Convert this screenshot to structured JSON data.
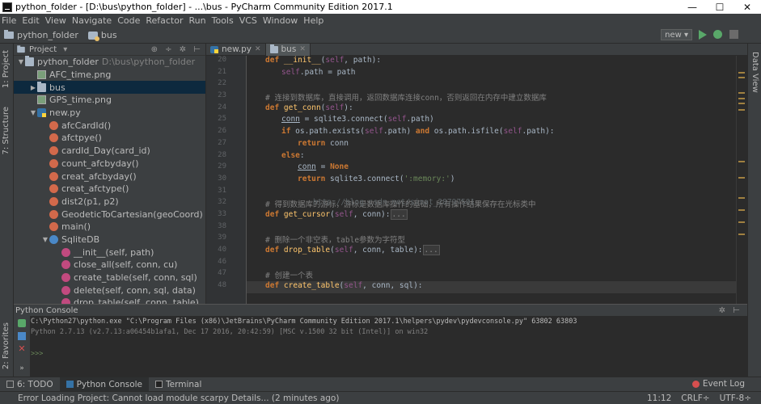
{
  "window": {
    "title": "python_folder - [D:\\bus\\python_folder] - ...\\bus - PyCharm Community Edition 2017.1",
    "minimize": "—",
    "maximize": "☐",
    "close": "✕"
  },
  "menu": [
    "File",
    "Edit",
    "View",
    "Navigate",
    "Code",
    "Refactor",
    "Run",
    "Tools",
    "VCS",
    "Window",
    "Help"
  ],
  "breadcrumb": {
    "project": "python_folder",
    "folder": "bus"
  },
  "run_config": {
    "label": "new ▾"
  },
  "side_tabs": {
    "project": "1: Project",
    "structure": "7: Structure",
    "favorites": "2: Favorites",
    "dataview": "Data View"
  },
  "project_panel": {
    "selector": "Project",
    "tree": [
      {
        "label": "python_folder",
        "path": "D:\\bus\\python_folder",
        "icon": "folder",
        "indent": 0,
        "arrow": "▼"
      },
      {
        "label": "AFC_time.png",
        "icon": "img",
        "indent": 1,
        "arrow": ""
      },
      {
        "label": "bus",
        "icon": "folder",
        "indent": 1,
        "arrow": "▶",
        "selected": true
      },
      {
        "label": "GPS_time.png",
        "icon": "img",
        "indent": 1,
        "arrow": ""
      },
      {
        "label": "new.py",
        "icon": "py",
        "indent": 1,
        "arrow": "▼"
      },
      {
        "label": "afcCardId()",
        "icon": "fn",
        "indent": 2,
        "arrow": ""
      },
      {
        "label": "afctpye()",
        "icon": "fn",
        "indent": 2,
        "arrow": ""
      },
      {
        "label": "cardId_Day(card_id)",
        "icon": "fn",
        "indent": 2,
        "arrow": ""
      },
      {
        "label": "count_afcbyday()",
        "icon": "fn",
        "indent": 2,
        "arrow": ""
      },
      {
        "label": "creat_afcbyday()",
        "icon": "fn",
        "indent": 2,
        "arrow": ""
      },
      {
        "label": "creat_afctype()",
        "icon": "fn",
        "indent": 2,
        "arrow": ""
      },
      {
        "label": "dist2(p1, p2)",
        "icon": "fn",
        "indent": 2,
        "arrow": ""
      },
      {
        "label": "GeodeticToCartesian(geoCoord)",
        "icon": "fn",
        "indent": 2,
        "arrow": ""
      },
      {
        "label": "main()",
        "icon": "fn",
        "indent": 2,
        "arrow": ""
      },
      {
        "label": "SqliteDB",
        "icon": "c",
        "indent": 2,
        "arrow": "▼"
      },
      {
        "label": "__init__(self, path)",
        "icon": "m",
        "indent": 3,
        "arrow": ""
      },
      {
        "label": "close_all(self, conn, cu)",
        "icon": "m",
        "indent": 3,
        "arrow": ""
      },
      {
        "label": "create_table(self, conn, sql)",
        "icon": "m",
        "indent": 3,
        "arrow": ""
      },
      {
        "label": "delete(self, conn, sql, data)",
        "icon": "m",
        "indent": 3,
        "arrow": ""
      },
      {
        "label": "drop_table(self, conn, table)",
        "icon": "m",
        "indent": 3,
        "arrow": ""
      }
    ]
  },
  "editor_tabs": [
    {
      "label": "new.py",
      "active": false
    },
    {
      "label": "bus",
      "active": true
    }
  ],
  "code_lines": [
    {
      "n": "20",
      "html": "<span class='kw'>def</span> <span class='fnn'>__init__</span><span class='plain'>(</span><span class='self'>self</span><span class='plain'>, path):</span>",
      "indent": 0
    },
    {
      "n": "21",
      "html": "<span class='self'>self</span><span class='plain'>.path = path</span>",
      "indent": 1
    },
    {
      "n": "22",
      "html": "",
      "indent": 0
    },
    {
      "n": "23",
      "html": "<span class='cm'># 连接到数据库，直接调用，返回数据库连接conn，否则返回在内存中建立数据库</span>",
      "indent": 0
    },
    {
      "n": "24",
      "html": "<span class='kw'>def</span> <span class='fnn'>get_conn</span><span class='plain'>(</span><span class='self'>self</span><span class='plain'>):</span>",
      "indent": 0
    },
    {
      "n": "25",
      "html": "<span class='plain' style='text-decoration:underline'>conn</span><span class='plain'> = sqlite3.connect(</span><span class='self'>self</span><span class='plain'>.path)</span>",
      "indent": 1
    },
    {
      "n": "26",
      "html": "<span class='kw'>if</span><span class='plain'> os.path.exists(</span><span class='self'>self</span><span class='plain'>.path) </span><span class='kw'>and</span><span class='plain'> os.path.isfile(</span><span class='self'>self</span><span class='plain'>.path):</span>",
      "indent": 1
    },
    {
      "n": "27",
      "html": "<span class='kw'>return</span><span class='plain'> conn</span>",
      "indent": 2
    },
    {
      "n": "28",
      "html": "<span class='kw'>else</span><span class='plain'>:</span>",
      "indent": 1
    },
    {
      "n": "29",
      "html": "<span class='plain' style='text-decoration:underline'>conn</span><span class='plain'> = </span><span class='kw'>None</span>",
      "indent": 2
    },
    {
      "n": "30",
      "html": "<span class='kw'>return</span><span class='plain'> sqlite3.connect(</span><span class='str'>':memory:'</span><span class='plain'>)</span>",
      "indent": 2
    },
    {
      "n": "31",
      "html": "",
      "indent": 0
    },
    {
      "n": "32",
      "html": "<span class='cm'># 得到数据库的游标，游标是数据库操作的基础，所有操作结果保存在光标类中</span>",
      "indent": 0
    },
    {
      "n": "33",
      "html": "<span class='kw'>def</span> <span class='fnn'>get_cursor</span><span class='plain'>(</span><span class='self'>self</span><span class='plain'>, conn):</span><span class='fold'>...</span>",
      "indent": 0
    },
    {
      "n": "38",
      "html": "",
      "indent": 0
    },
    {
      "n": "39",
      "html": "<span class='cm'># 删除一个非空表，table参数为字符型</span>",
      "indent": 0
    },
    {
      "n": "40",
      "html": "<span class='kw'>def</span> <span class='fnn'>drop_table</span><span class='plain'>(</span><span class='self'>self</span><span class='plain'>, conn, table):</span><span class='fold'>...</span>",
      "indent": 0
    },
    {
      "n": "46",
      "html": "",
      "indent": 0
    },
    {
      "n": "47",
      "html": "<span class='cm'># 创建一个表</span>",
      "indent": 0
    },
    {
      "n": "48",
      "html": "<span class='kw'>def</span> <span class='fnn'>create_table</span><span class='plain'>(</span><span class='self'>self</span><span class='plain'>, conn, sql):</span>",
      "indent": 0
    }
  ],
  "watermark": "http://blog.csdn.net/sinat_28797501",
  "console": {
    "title": "Python Console",
    "lines": [
      "C:\\Python27\\python.exe \"C:\\Program Files (x86)\\JetBrains\\PyCharm Community Edition 2017.1\\helpers\\pydev\\pydevconsole.py\" 63802 63803",
      "Python 2.7.13 (v2.7.13:a06454b1afa1, Dec 17 2016, 20:42:59) [MSC v.1500 32 bit (Intel)] on win32"
    ],
    "prompt": ">>>"
  },
  "bottom_tabs": [
    "6: TODO",
    "Python Console",
    "Terminal"
  ],
  "event_log": "Event Log",
  "status": {
    "message": "Error Loading Project: Cannot load module scarpy Details... (2 minutes ago)",
    "position": "11:12",
    "line_sep": "CRLF÷",
    "encoding": "UTF-8÷"
  }
}
